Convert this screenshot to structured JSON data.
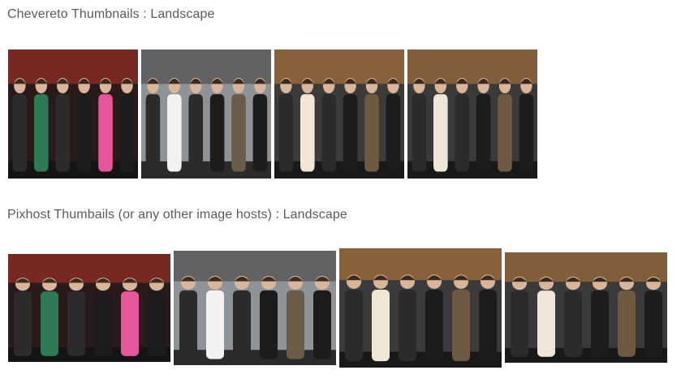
{
  "sections": [
    {
      "title": "Chevereto Thumbnails : Landscape",
      "thumbnails": [
        {
          "label": "red carpet group photo 1",
          "palette": {
            "bg": "#2a1a1a",
            "accent": "#b8352b",
            "dress": "#2d7a55",
            "dress2": "#e6569b"
          }
        },
        {
          "label": "red carpet group photo 2",
          "palette": {
            "bg": "#8e9397",
            "accent": "#3a3a3a",
            "dress": "#f2f2f2",
            "dress2": "#6b5c49"
          }
        },
        {
          "label": "premiere group photo 3",
          "palette": {
            "bg": "#3b3b3b",
            "accent": "#c8813a",
            "dress": "#f2e7d6",
            "dress2": "#6d5a40"
          }
        },
        {
          "label": "premiere group photo 4",
          "palette": {
            "bg": "#3a3a3a",
            "accent": "#bb7a3a",
            "dress": "#f0e6d8",
            "dress2": "#6d5a40"
          }
        }
      ]
    },
    {
      "title": "Pixhost Thumbails (or any other image hosts) : Landscape",
      "thumbnails": [
        {
          "label": "red carpet group photo 1",
          "palette": {
            "bg": "#2a1a1a",
            "accent": "#b8352b",
            "dress": "#2d7a55",
            "dress2": "#e6569b"
          }
        },
        {
          "label": "red carpet group photo 2",
          "palette": {
            "bg": "#8e9397",
            "accent": "#3a3a3a",
            "dress": "#f2f2f2",
            "dress2": "#6b5c49"
          }
        },
        {
          "label": "premiere group photo 3",
          "palette": {
            "bg": "#3b3b3b",
            "accent": "#c8813a",
            "dress": "#f2e7d6",
            "dress2": "#6d5a40"
          }
        },
        {
          "label": "premiere group photo 4",
          "palette": {
            "bg": "#3a3a3a",
            "accent": "#bb7a3a",
            "dress": "#f0e6d8",
            "dress2": "#6d5a40"
          }
        }
      ]
    }
  ]
}
